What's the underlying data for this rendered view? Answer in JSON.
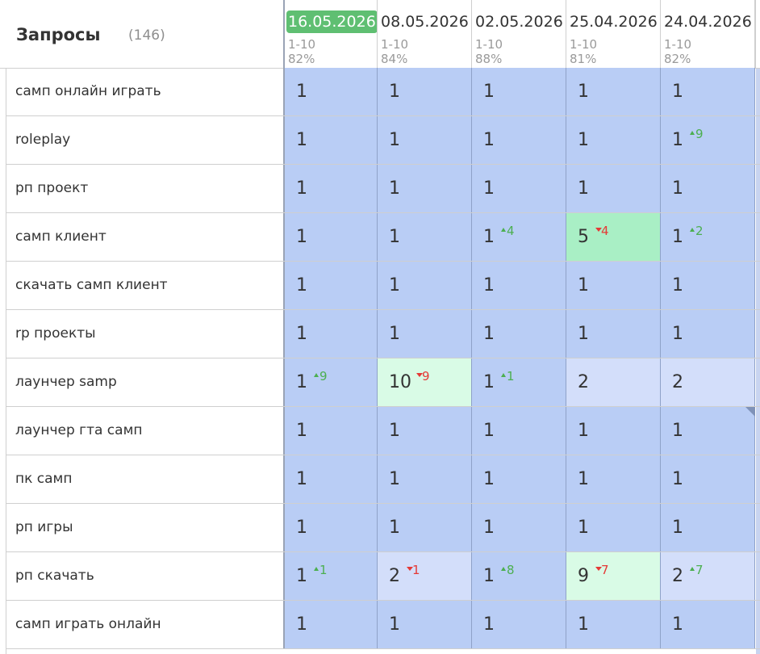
{
  "header": {
    "title": "Запросы",
    "count": "(146)",
    "dates": [
      {
        "date": "16.05.2026",
        "range": "1-10",
        "pct": "82%",
        "active": true
      },
      {
        "date": "08.05.2026",
        "range": "1-10",
        "pct": "84%",
        "active": false
      },
      {
        "date": "02.05.2026",
        "range": "1-10",
        "pct": "88%",
        "active": false
      },
      {
        "date": "25.04.2026",
        "range": "1-10",
        "pct": "81%",
        "active": false
      },
      {
        "date": "24.04.2026",
        "range": "1-10",
        "pct": "82%",
        "active": false
      }
    ]
  },
  "colors": {
    "active_date": "#5fbf72",
    "cell_blue": "#b9cdf5",
    "cell_light": "#d3defa",
    "cell_green": "#a9efc5",
    "cell_mint": "#d9fbe6",
    "delta_up": "#4caf50",
    "delta_down": "#e53935"
  },
  "rows": [
    {
      "query": "самп онлайн играть",
      "cells": [
        {
          "v": "1",
          "c": "blue"
        },
        {
          "v": "1",
          "c": "blue"
        },
        {
          "v": "1",
          "c": "blue"
        },
        {
          "v": "1",
          "c": "blue"
        },
        {
          "v": "1",
          "c": "blue"
        }
      ]
    },
    {
      "query": "roleplay",
      "cells": [
        {
          "v": "1",
          "c": "blue"
        },
        {
          "v": "1",
          "c": "blue"
        },
        {
          "v": "1",
          "c": "blue"
        },
        {
          "v": "1",
          "c": "blue"
        },
        {
          "v": "1",
          "c": "blue",
          "d": "9",
          "dir": "up"
        }
      ]
    },
    {
      "query": "рп проект",
      "cells": [
        {
          "v": "1",
          "c": "blue"
        },
        {
          "v": "1",
          "c": "blue"
        },
        {
          "v": "1",
          "c": "blue"
        },
        {
          "v": "1",
          "c": "blue"
        },
        {
          "v": "1",
          "c": "blue"
        }
      ]
    },
    {
      "query": "самп клиент",
      "cells": [
        {
          "v": "1",
          "c": "blue"
        },
        {
          "v": "1",
          "c": "blue"
        },
        {
          "v": "1",
          "c": "blue",
          "d": "4",
          "dir": "up"
        },
        {
          "v": "5",
          "c": "green",
          "d": "4",
          "dir": "down"
        },
        {
          "v": "1",
          "c": "blue",
          "d": "2",
          "dir": "up"
        }
      ]
    },
    {
      "query": "скачать самп клиент",
      "cells": [
        {
          "v": "1",
          "c": "blue"
        },
        {
          "v": "1",
          "c": "blue"
        },
        {
          "v": "1",
          "c": "blue"
        },
        {
          "v": "1",
          "c": "blue"
        },
        {
          "v": "1",
          "c": "blue"
        }
      ]
    },
    {
      "query": "rp проекты",
      "cells": [
        {
          "v": "1",
          "c": "blue"
        },
        {
          "v": "1",
          "c": "blue"
        },
        {
          "v": "1",
          "c": "blue"
        },
        {
          "v": "1",
          "c": "blue"
        },
        {
          "v": "1",
          "c": "blue"
        }
      ]
    },
    {
      "query": "лаунчер samp",
      "cells": [
        {
          "v": "1",
          "c": "blue",
          "d": "9",
          "dir": "up"
        },
        {
          "v": "10",
          "c": "mint",
          "d": "9",
          "dir": "down"
        },
        {
          "v": "1",
          "c": "blue",
          "d": "1",
          "dir": "up"
        },
        {
          "v": "2",
          "c": "light"
        },
        {
          "v": "2",
          "c": "light"
        }
      ]
    },
    {
      "query": "лаунчер гта самп",
      "cells": [
        {
          "v": "1",
          "c": "blue"
        },
        {
          "v": "1",
          "c": "blue"
        },
        {
          "v": "1",
          "c": "blue"
        },
        {
          "v": "1",
          "c": "blue"
        },
        {
          "v": "1",
          "c": "blue"
        }
      ]
    },
    {
      "query": "пк самп",
      "cells": [
        {
          "v": "1",
          "c": "blue"
        },
        {
          "v": "1",
          "c": "blue"
        },
        {
          "v": "1",
          "c": "blue"
        },
        {
          "v": "1",
          "c": "blue"
        },
        {
          "v": "1",
          "c": "blue"
        }
      ]
    },
    {
      "query": "рп игры",
      "cells": [
        {
          "v": "1",
          "c": "blue"
        },
        {
          "v": "1",
          "c": "blue"
        },
        {
          "v": "1",
          "c": "blue"
        },
        {
          "v": "1",
          "c": "blue"
        },
        {
          "v": "1",
          "c": "blue"
        }
      ]
    },
    {
      "query": "рп скачать",
      "cells": [
        {
          "v": "1",
          "c": "blue",
          "d": "1",
          "dir": "up"
        },
        {
          "v": "2",
          "c": "light",
          "d": "1",
          "dir": "down"
        },
        {
          "v": "1",
          "c": "blue",
          "d": "8",
          "dir": "up"
        },
        {
          "v": "9",
          "c": "mint",
          "d": "7",
          "dir": "down"
        },
        {
          "v": "2",
          "c": "light",
          "d": "7",
          "dir": "up"
        }
      ]
    },
    {
      "query": "самп играть онлайн",
      "cells": [
        {
          "v": "1",
          "c": "blue"
        },
        {
          "v": "1",
          "c": "blue"
        },
        {
          "v": "1",
          "c": "blue"
        },
        {
          "v": "1",
          "c": "blue"
        },
        {
          "v": "1",
          "c": "blue"
        }
      ]
    }
  ]
}
